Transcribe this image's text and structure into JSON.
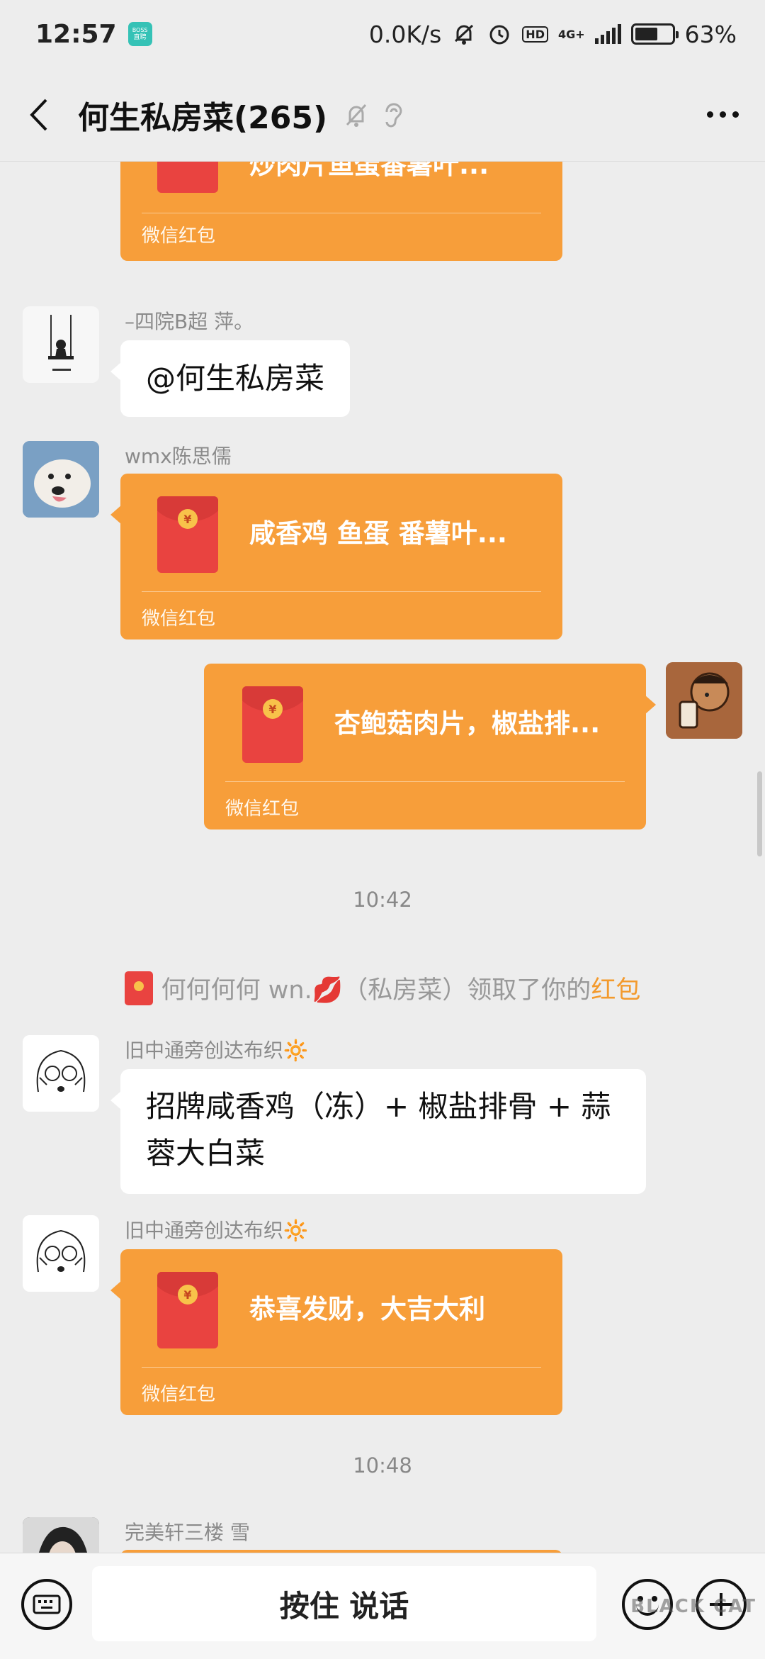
{
  "status_bar": {
    "time": "12:57",
    "boss_badge": "BOSS直聘",
    "net_speed": "0.0K/s",
    "hd": "HD",
    "network": "4G+",
    "battery": "63%",
    "battery_level": 0.63
  },
  "header": {
    "title": "何生私房菜(265)"
  },
  "messages": {
    "rp0": {
      "text": "炒肉片鱼蛋番薯叶...",
      "label": "微信红包"
    },
    "m1": {
      "sender": "–四院B超  萍。",
      "text": "@何生私房菜"
    },
    "m2": {
      "sender": "wmx陈思儒",
      "text": "咸香鸡 鱼蛋 番薯叶...",
      "label": "微信红包"
    },
    "m3": {
      "text": "杏鲍菇肉片，椒盐排...",
      "label": "微信红包"
    },
    "time1": "10:42",
    "notice": {
      "prefix": "何何何何 wn.💋（私房菜）领取了你的",
      "highlight": "红包"
    },
    "m4": {
      "sender": "旧中通旁创达布织🔆",
      "line1": "招牌咸香鸡（冻）+ 椒盐排骨 + 蒜",
      "line2": "蓉大白菜"
    },
    "m5": {
      "sender": "旧中通旁创达布织🔆",
      "text": "恭喜发财，大吉大利",
      "label": "微信红包"
    },
    "time2": "10:48",
    "m6": {
      "sender": "完美轩三楼 雪"
    }
  },
  "input_bar": {
    "hold_to_talk": "按住 说话",
    "watermark": "BLACK CAT"
  },
  "colors": {
    "red_packet": "#f79e3a",
    "envelope": "#e94340",
    "background": "#ededed",
    "highlight": "#f39a2d"
  }
}
